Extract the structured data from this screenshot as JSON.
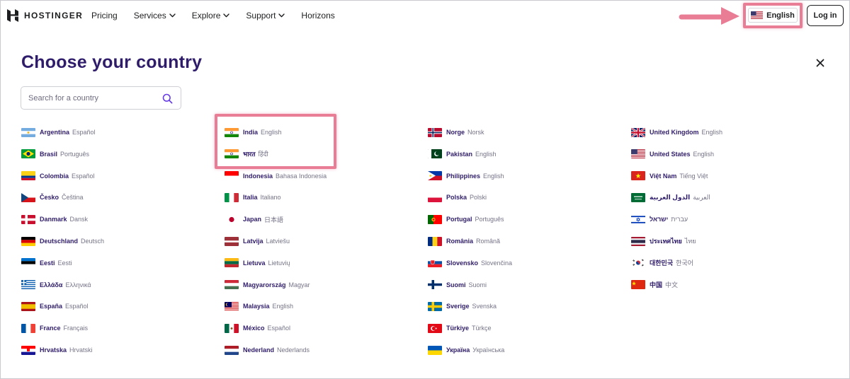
{
  "header": {
    "brand": "HOSTINGER",
    "nav": [
      {
        "label": "Pricing",
        "dropdown": false
      },
      {
        "label": "Services",
        "dropdown": true
      },
      {
        "label": "Explore",
        "dropdown": true
      },
      {
        "label": "Support",
        "dropdown": true
      },
      {
        "label": "Horizons",
        "dropdown": false
      }
    ],
    "language_label": "English",
    "login_label": "Log in"
  },
  "page": {
    "title": "Choose your country",
    "search_placeholder": "Search for a country"
  },
  "colors": {
    "accent": "#673de6",
    "title": "#2f1c6a",
    "highlight": "#e97d96"
  },
  "countries": [
    [
      {
        "name": "Argentina",
        "lang": "Español",
        "flag": "AR"
      },
      {
        "name": "Brasil",
        "lang": "Português",
        "flag": "BR"
      },
      {
        "name": "Colombia",
        "lang": "Español",
        "flag": "CO"
      },
      {
        "name": "Česko",
        "lang": "Čeština",
        "flag": "CZ"
      },
      {
        "name": "Danmark",
        "lang": "Dansk",
        "flag": "DK"
      },
      {
        "name": "Deutschland",
        "lang": "Deutsch",
        "flag": "DE"
      },
      {
        "name": "Eesti",
        "lang": "Eesti",
        "flag": "EE"
      },
      {
        "name": "Ελλάδα",
        "lang": "Ελληνικά",
        "flag": "GR"
      },
      {
        "name": "España",
        "lang": "Español",
        "flag": "ES"
      },
      {
        "name": "France",
        "lang": "Français",
        "flag": "FR"
      },
      {
        "name": "Hrvatska",
        "lang": "Hrvatski",
        "flag": "HR"
      }
    ],
    [
      {
        "name": "India",
        "lang": "English",
        "flag": "IN"
      },
      {
        "name": "भारत",
        "lang": "हिंदी",
        "flag": "IN"
      },
      {
        "name": "Indonesia",
        "lang": "Bahasa Indonesia",
        "flag": "ID"
      },
      {
        "name": "Italia",
        "lang": "Italiano",
        "flag": "IT"
      },
      {
        "name": "Japan",
        "lang": "日本語",
        "flag": "JP"
      },
      {
        "name": "Latvija",
        "lang": "Latviešu",
        "flag": "LV"
      },
      {
        "name": "Lietuva",
        "lang": "Lietuvių",
        "flag": "LT"
      },
      {
        "name": "Magyarország",
        "lang": "Magyar",
        "flag": "HU"
      },
      {
        "name": "Malaysia",
        "lang": "English",
        "flag": "MY"
      },
      {
        "name": "México",
        "lang": "Español",
        "flag": "MX"
      },
      {
        "name": "Nederland",
        "lang": "Nederlands",
        "flag": "NL"
      }
    ],
    [
      {
        "name": "Norge",
        "lang": "Norsk",
        "flag": "NO"
      },
      {
        "name": "Pakistan",
        "lang": "English",
        "flag": "PK"
      },
      {
        "name": "Philippines",
        "lang": "English",
        "flag": "PH"
      },
      {
        "name": "Polska",
        "lang": "Polski",
        "flag": "PL"
      },
      {
        "name": "Portugal",
        "lang": "Português",
        "flag": "PT"
      },
      {
        "name": "România",
        "lang": "Română",
        "flag": "RO"
      },
      {
        "name": "Slovensko",
        "lang": "Slovenčina",
        "flag": "SK"
      },
      {
        "name": "Suomi",
        "lang": "Suomi",
        "flag": "FI"
      },
      {
        "name": "Sverige",
        "lang": "Svenska",
        "flag": "SE"
      },
      {
        "name": "Türkiye",
        "lang": "Türkçe",
        "flag": "TR"
      },
      {
        "name": "Україна",
        "lang": "Українська",
        "flag": "UA"
      }
    ],
    [
      {
        "name": "United Kingdom",
        "lang": "English",
        "flag": "GB"
      },
      {
        "name": "United States",
        "lang": "English",
        "flag": "US"
      },
      {
        "name": "Việt Nam",
        "lang": "Tiếng Việt",
        "flag": "VN"
      },
      {
        "name": "الدول العربية",
        "lang": "العربية",
        "flag": "SA"
      },
      {
        "name": "ישראל",
        "lang": "עברית",
        "flag": "IL"
      },
      {
        "name": "ประเทศไทย",
        "lang": "ไทย",
        "flag": "TH"
      },
      {
        "name": "대한민국",
        "lang": "한국어",
        "flag": "KR"
      },
      {
        "name": "中国",
        "lang": "中文",
        "flag": "CN"
      }
    ]
  ]
}
